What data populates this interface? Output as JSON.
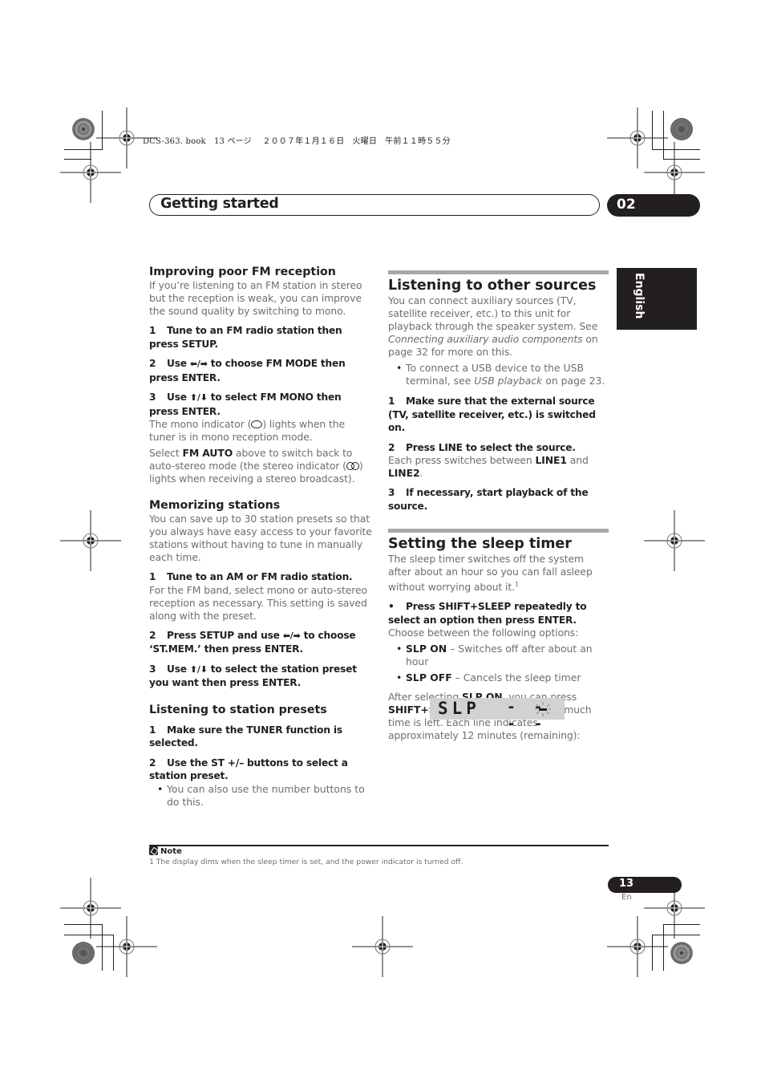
{
  "print_meta": {
    "file": "DCS-363. book",
    "page": "13",
    "page_suffix": "ページ",
    "date": "２００７年１月１６日",
    "weekday": "火曜日",
    "time": "午前１１時５５分"
  },
  "chapter": {
    "title": "Getting started",
    "number": "02"
  },
  "language_tab": "English",
  "left_column": {
    "fm_reception": {
      "heading": "Improving poor FM reception",
      "intro": "If you’re listening to an FM station in stereo but the reception is weak, you can improve the sound quality by switching to mono.",
      "step1_num": "1",
      "step1": "Tune to an FM radio station then press SETUP.",
      "step2_num": "2",
      "step2_a": "Use",
      "step2_arrows": "⬅/➡",
      "step2_b": "to choose FM MODE then press ENTER.",
      "step3_num": "3",
      "step3_a": "Use",
      "step3_arrows": "⬆/⬇",
      "step3_b": "to select FM MONO then press ENTER.",
      "mono_a": "The mono indicator (",
      "mono_b": ") lights when the tuner is in mono reception mode.",
      "auto_a": "Select",
      "auto_bold": "FM AUTO",
      "auto_b": "above to switch back to auto-stereo mode (the stereo indicator (",
      "auto_c": ") lights when receiving a stereo broadcast)."
    },
    "memorizing": {
      "heading": "Memorizing stations",
      "intro": "You can save up to 30 station presets so that you always have easy access to your favorite stations without having to tune in manually each time.",
      "step1_num": "1",
      "step1": "Tune to an AM or FM radio station.",
      "step1_body": "For the FM band, select mono or auto-stereo reception as necessary. This setting is saved along with the preset.",
      "step2_num": "2",
      "step2_a": "Press SETUP and use",
      "step2_arrows": "⬅/➡",
      "step2_b": "to choose ‘ST.MEM.’ then press ENTER.",
      "step3_num": "3",
      "step3_a": "Use",
      "step3_arrows": "⬆/⬇",
      "step3_b": "to select the station preset you want then press ENTER."
    },
    "presets": {
      "heading": "Listening to station presets",
      "step1_num": "1",
      "step1": "Make sure the TUNER function is selected.",
      "step2_num": "2",
      "step2": "Use the ST +/– buttons to select a station preset.",
      "bullet": "You can also use the number buttons to do this."
    }
  },
  "right_column": {
    "other_sources": {
      "heading": "Listening to other sources",
      "intro_a": "You can connect auxiliary sources (TV, satellite receiver, etc.) to this unit for playback through the speaker system. See",
      "intro_link": "Connecting auxiliary audio components",
      "intro_b": "on page 32 for more on this.",
      "bullet_a": "To connect a USB device to the USB terminal, see",
      "bullet_link": "USB playback",
      "bullet_b": "on page 23.",
      "step1_num": "1",
      "step1": "Make sure that the external source (TV, satellite receiver, etc.) is switched on.",
      "step2_num": "2",
      "step2": "Press LINE to select the source.",
      "step2_body_a": "Each press switches between",
      "step2_line1": "LINE1",
      "step2_and": "and",
      "step2_line2": "LINE2",
      "step2_end": ".",
      "step3_num": "3",
      "step3": "If necessary, start playback of the source."
    },
    "sleep_timer": {
      "heading": "Setting the sleep timer",
      "intro": "The sleep timer switches off the system after about an hour so you can fall asleep without worrying about it.",
      "footnote_ref": "1",
      "step_bullet": "•",
      "step": "Press SHIFT+SLEEP repeatedly to select an option then press ENTER.",
      "choose": "Choose between the following options:",
      "options": [
        {
          "label": "SLP ON",
          "desc": "– Switches off after about an hour"
        },
        {
          "label": "SLP OFF",
          "desc": "– Cancels the sleep timer"
        }
      ],
      "after_a": "After selecting",
      "after_bold1": "SLP ON",
      "after_b": ", you can press",
      "after_bold2": "SHIFT+SLEEP",
      "after_c": "again to check how much time is left. Each line indicates approximately 12 minutes (remaining):",
      "display_label": "SLP",
      "display_dashes": "- - - -",
      "display_remaining_segments": 4
    }
  },
  "note": {
    "label": "Note",
    "text": "1 The display dims when the sleep timer is set, and the power indicator is turned off."
  },
  "footer": {
    "page_number": "13",
    "language_code": "En"
  }
}
